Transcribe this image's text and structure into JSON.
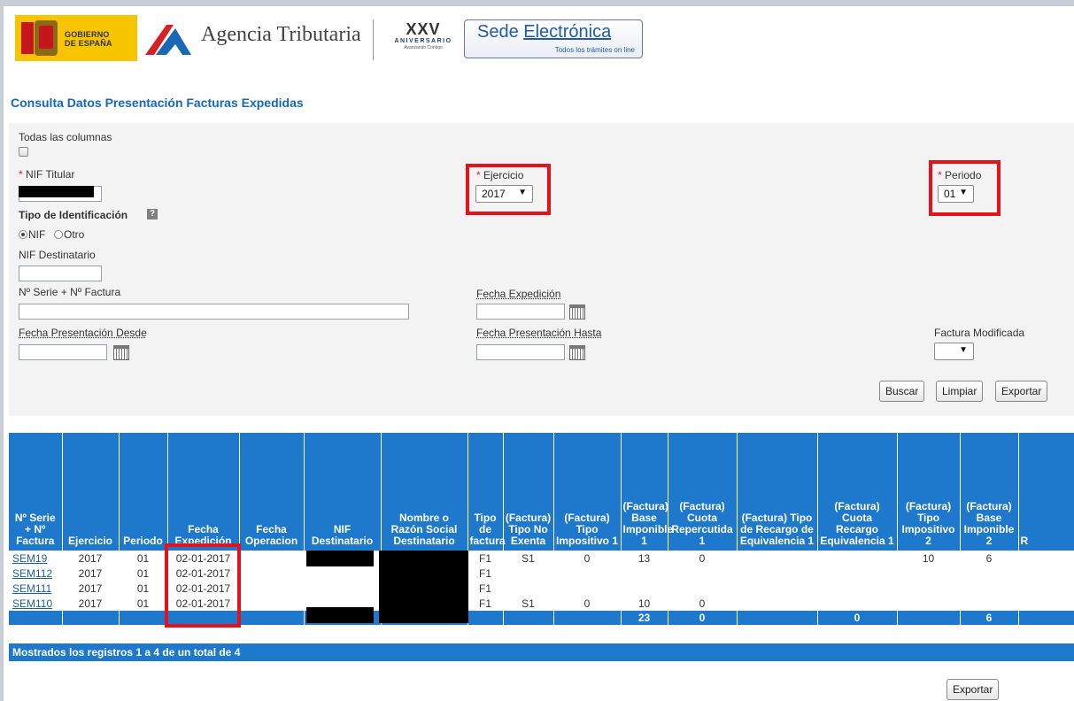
{
  "header": {
    "gob_line1": "GOBIERNO",
    "gob_line2": "DE ESPAÑA",
    "agency": "Agencia Tributaria",
    "anniversary_mark": "XXV",
    "anniversary_word": "ANIVERSARIO",
    "anniversary_tag": "Avanzando Contigo",
    "sede_prefix": "Sede ",
    "sede_main": "Electrónica",
    "sede_sub": "Todos los trámites on line"
  },
  "page_title": "Consulta Datos Presentación Facturas Expedidas",
  "form": {
    "all_columns_label": "Todas las columnas",
    "nif_titular_label": "NIF Titular",
    "required_mark": "*",
    "ejercicio_label": "Ejercicio",
    "ejercicio_value": "2017",
    "periodo_label": "Periodo",
    "periodo_value": "01",
    "tipo_ident_label": "Tipo de Identificación",
    "help_mark": "?",
    "radio_nif": "NIF",
    "radio_otro": "Otro",
    "nif_dest_label": "NIF Destinatario",
    "serie_label": "Nº Serie + Nº Factura",
    "fecha_exp_label": "Fecha Expedición",
    "fecha_desde_label": "Fecha Presentación Desde",
    "fecha_hasta_label": "Fecha Presentación Hasta",
    "fact_mod_label": "Factura Modificada",
    "fact_mod_value": ""
  },
  "buttons": {
    "buscar": "Buscar",
    "limpiar": "Limpiar",
    "exportar": "Exportar"
  },
  "table": {
    "columns": [
      "Nº Serie + Nº Factura",
      "Ejercicio",
      "Periodo",
      "Fecha Expedición",
      "Fecha Operacion",
      "NIF Destinatario",
      "Nombre o Razón Social Destinatario",
      "Tipo de factura",
      "(Factura) Tipo No Exenta",
      "(Factura) Tipo Impositivo 1",
      "(Factura) Base Imponible 1",
      "(Factura) Cuota Repercutida 1",
      "(Factura) Tipo de Recargo de Equivalencia 1",
      "(Factura) Cuota Recargo Equivalencia 1",
      "(Factura) Tipo Impositivo 2",
      "(Factura) Base Imponible 2",
      "R"
    ],
    "rows": [
      [
        "SEM19",
        "2017",
        "01",
        "02-01-2017",
        "",
        "",
        "",
        "F1",
        "S1",
        "0",
        "13",
        "0",
        "",
        "",
        "10",
        "6",
        ""
      ],
      [
        "SEM112",
        "2017",
        "01",
        "02-01-2017",
        "",
        "",
        "",
        "F1",
        "",
        "",
        "",
        "",
        "",
        "",
        "",
        "",
        ""
      ],
      [
        "SEM111",
        "2017",
        "01",
        "02-01-2017",
        "",
        "",
        "",
        "F1",
        "",
        "",
        "",
        "",
        "",
        "",
        "",
        "",
        ""
      ],
      [
        "SEM110",
        "2017",
        "01",
        "02-01-2017",
        "",
        "",
        "",
        "F1",
        "S1",
        "0",
        "10",
        "0",
        "",
        "",
        "",
        "",
        ""
      ]
    ],
    "totals": [
      "",
      "",
      "",
      "",
      "",
      "",
      "",
      "",
      "",
      "",
      "23",
      "0",
      "",
      "0",
      "",
      "6",
      ""
    ],
    "status": "Mostrados los registros 1 a 4 de un total de 4"
  }
}
